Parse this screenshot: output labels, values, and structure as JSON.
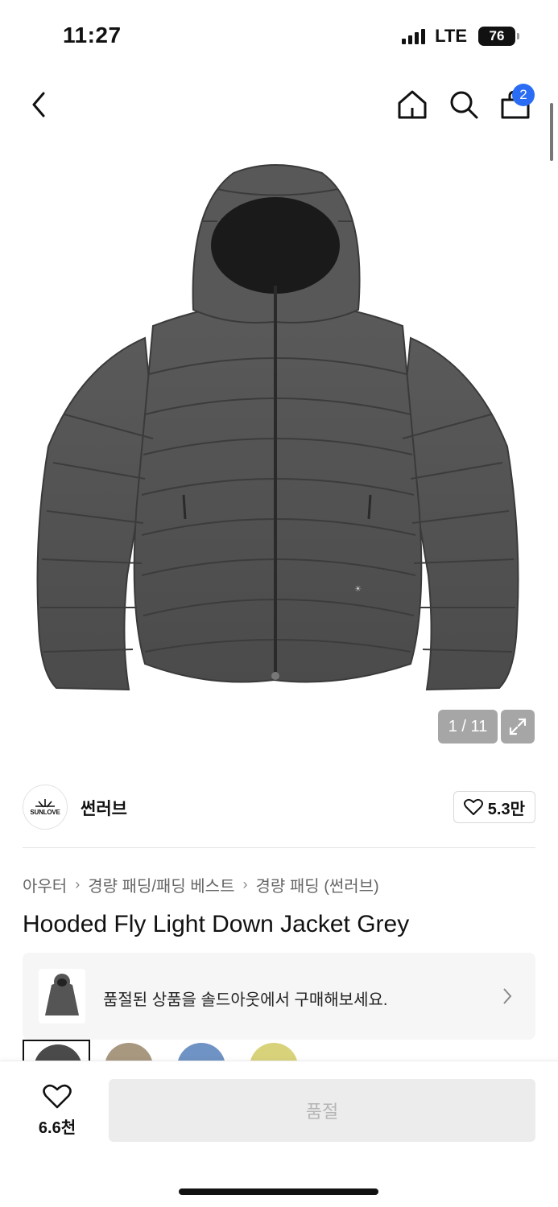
{
  "status": {
    "time": "11:27",
    "network": "LTE",
    "battery": "76"
  },
  "nav": {
    "cart_count": "2",
    "icons": [
      "chevron-left-icon",
      "home-icon",
      "search-icon",
      "bag-icon"
    ]
  },
  "gallery": {
    "counter": "1 / 11"
  },
  "brand": {
    "logo_text": "SUNLOVE",
    "name": "썬러브",
    "likes": "5.3만"
  },
  "breadcrumb": [
    "아우터",
    "경량 패딩/패딩 베스트",
    "경량 패딩 (썬러브)"
  ],
  "product": {
    "title": "Hooded Fly Light Down Jacket Grey"
  },
  "soldout_banner": {
    "text": "품절된 상품을 솔드아웃에서 구매해보세요."
  },
  "swatch_colors": [
    "#4a4a4a",
    "#a89880",
    "#6f93c4",
    "#d8d37a"
  ],
  "bottom": {
    "wish_count": "6.6천",
    "buy_label": "품절"
  }
}
